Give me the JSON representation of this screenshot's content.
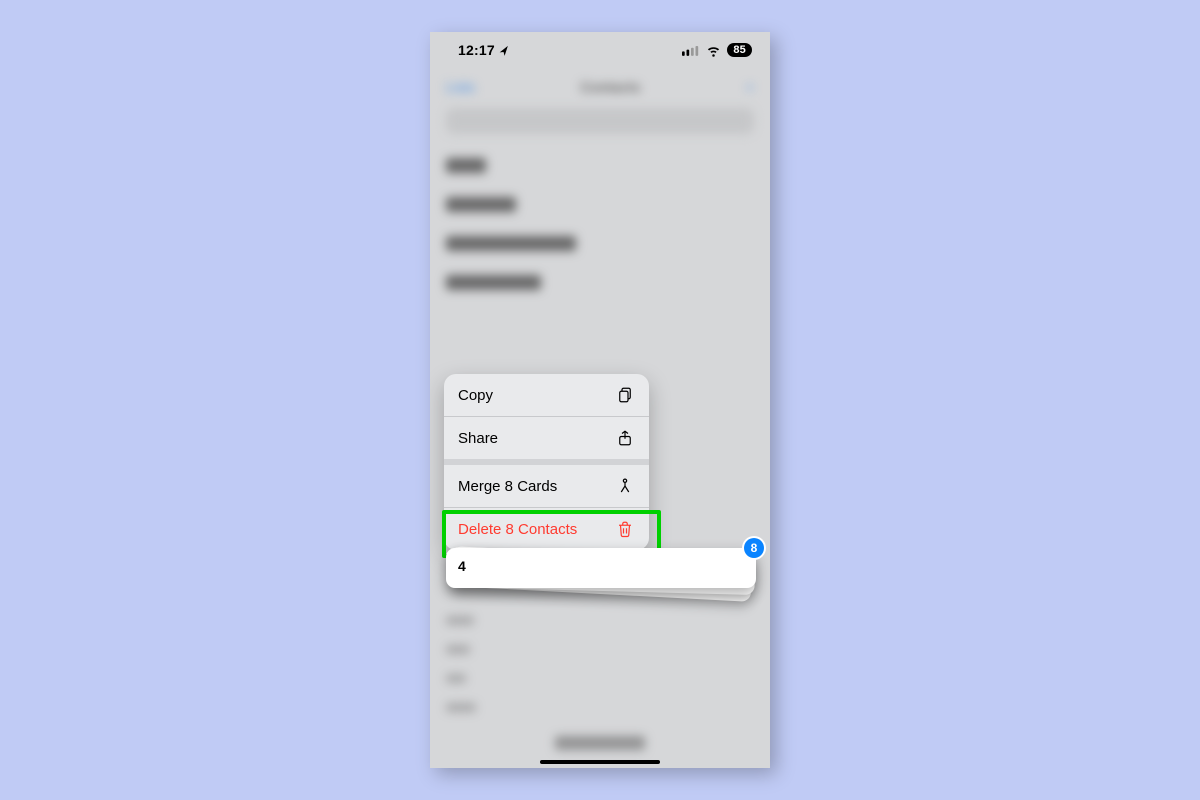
{
  "status_bar": {
    "time": "12:17",
    "battery_pct": "85"
  },
  "blur_nav": {
    "left": "Lists",
    "title": "Contacts",
    "right": "+"
  },
  "context_menu": {
    "copy_label": "Copy",
    "share_label": "Share",
    "merge_label": "Merge 8 Cards",
    "delete_label": "Delete 8 Contacts"
  },
  "card_stack": {
    "top_label": "4",
    "badge_count": "8"
  }
}
